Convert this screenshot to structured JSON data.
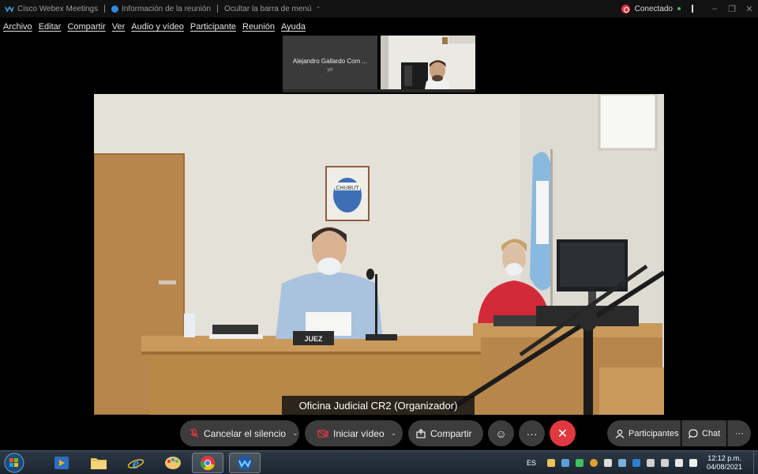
{
  "titlebar": {
    "app_name": "Cisco Webex Meetings",
    "info_label": "Información de la reunión",
    "hide_menu_label": "Ocultar la barra de menú",
    "status": "Conectado",
    "minimize": "–",
    "restore": "❐",
    "close": "✕"
  },
  "menu": [
    "Archivo",
    "Editar",
    "Compartir",
    "Ver",
    "Audio y vídeo",
    "Participante",
    "Reunión",
    "Ayuda"
  ],
  "thumbnails": {
    "participant_name": "Alejandro Gallardo Com ...",
    "participant_sub": "yo"
  },
  "main_video": {
    "name_badge": "Oficina Judicial CR2 (Organizador)",
    "desk_plate": "JUEZ",
    "sign_text": "CHUBUT"
  },
  "controls": {
    "mute_label": "Cancelar el silencio",
    "video_label": "Iniciar vídeo",
    "share_label": "Compartir",
    "reactions_icon": "☺",
    "more_icon": "···",
    "end_icon": "✕",
    "participants_label": "Participantes",
    "chat_label": "Chat",
    "options_icon": "···"
  },
  "taskbar": {
    "language": "ES",
    "time": "12:12 p.m.",
    "date": "04/08/2021"
  },
  "colors": {
    "end_call": "#e0383f",
    "status_connected": "#3ec060",
    "control_bg": "#3c3c3c"
  }
}
